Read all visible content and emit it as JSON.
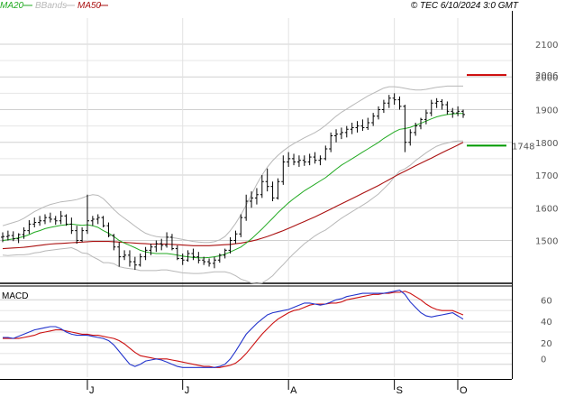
{
  "header": {
    "legend_ma20": "MA20",
    "legend_bbands": "BBands",
    "legend_ma50": "MA50",
    "source": "© TEC 6/10/2024 3:0 GMT"
  },
  "colors": {
    "ma20": "#22aa22",
    "bbands": "#b8b8b8",
    "ma50": "#aa1111",
    "macd_line": "#2233cc",
    "macd_signal": "#cc1111",
    "grid": "#d0d0d0",
    "price_bar": "#000000"
  },
  "chart_data": [
    {
      "type": "line",
      "title": "",
      "price_ylim": [
        1380,
        2180
      ],
      "price_yticks": [
        "1500",
        "1600",
        "1700",
        "1800",
        "1900",
        "2000",
        "2100"
      ],
      "months": [
        "J",
        "J",
        "A",
        "S",
        "O"
      ],
      "levels": [
        {
          "label": "2006",
          "value": 2006,
          "color": "#cc0000"
        },
        {
          "label": "1748",
          "value": 1790,
          "color": "#009900"
        }
      ],
      "ohlc": [
        [
          1510,
          1525,
          1495,
          1512
        ],
        [
          1512,
          1530,
          1500,
          1515
        ],
        [
          1515,
          1528,
          1498,
          1505
        ],
        [
          1505,
          1522,
          1492,
          1518
        ],
        [
          1518,
          1540,
          1505,
          1530
        ],
        [
          1530,
          1562,
          1520,
          1550
        ],
        [
          1550,
          1570,
          1540,
          1555
        ],
        [
          1555,
          1575,
          1545,
          1560
        ],
        [
          1560,
          1580,
          1550,
          1570
        ],
        [
          1570,
          1585,
          1555,
          1565
        ],
        [
          1565,
          1575,
          1548,
          1560
        ],
        [
          1560,
          1590,
          1550,
          1575
        ],
        [
          1575,
          1580,
          1545,
          1550
        ],
        [
          1550,
          1570,
          1520,
          1530
        ],
        [
          1530,
          1545,
          1490,
          1500
        ],
        [
          1500,
          1540,
          1495,
          1530
        ],
        [
          1530,
          1640,
          1520,
          1560
        ],
        [
          1560,
          1575,
          1545,
          1565
        ],
        [
          1565,
          1580,
          1550,
          1570
        ],
        [
          1570,
          1575,
          1540,
          1545
        ],
        [
          1545,
          1555,
          1510,
          1515
        ],
        [
          1515,
          1520,
          1470,
          1480
        ],
        [
          1480,
          1495,
          1420,
          1450
        ],
        [
          1450,
          1470,
          1440,
          1455
        ],
        [
          1455,
          1470,
          1420,
          1435
        ],
        [
          1435,
          1450,
          1410,
          1425
        ],
        [
          1425,
          1460,
          1420,
          1450
        ],
        [
          1450,
          1480,
          1440,
          1470
        ],
        [
          1470,
          1490,
          1455,
          1480
        ],
        [
          1480,
          1500,
          1465,
          1490
        ],
        [
          1490,
          1505,
          1470,
          1485
        ],
        [
          1485,
          1525,
          1478,
          1510
        ],
        [
          1510,
          1520,
          1470,
          1475
        ],
        [
          1475,
          1485,
          1440,
          1445
        ],
        [
          1445,
          1460,
          1425,
          1440
        ],
        [
          1440,
          1470,
          1435,
          1460
        ],
        [
          1460,
          1475,
          1440,
          1450
        ],
        [
          1450,
          1465,
          1430,
          1440
        ],
        [
          1440,
          1450,
          1425,
          1435
        ],
        [
          1435,
          1445,
          1420,
          1430
        ],
        [
          1430,
          1450,
          1415,
          1440
        ],
        [
          1440,
          1460,
          1432,
          1455
        ],
        [
          1455,
          1475,
          1445,
          1470
        ],
        [
          1470,
          1510,
          1460,
          1500
        ],
        [
          1500,
          1530,
          1490,
          1520
        ],
        [
          1520,
          1580,
          1510,
          1570
        ],
        [
          1570,
          1640,
          1560,
          1620
        ],
        [
          1620,
          1650,
          1600,
          1630
        ],
        [
          1630,
          1660,
          1610,
          1640
        ],
        [
          1640,
          1700,
          1630,
          1680
        ],
        [
          1680,
          1720,
          1650,
          1665
        ],
        [
          1665,
          1680,
          1620,
          1630
        ],
        [
          1630,
          1690,
          1625,
          1680
        ],
        [
          1680,
          1760,
          1670,
          1740
        ],
        [
          1740,
          1770,
          1725,
          1750
        ],
        [
          1750,
          1765,
          1730,
          1740
        ],
        [
          1740,
          1760,
          1725,
          1745
        ],
        [
          1745,
          1760,
          1728,
          1740
        ],
        [
          1740,
          1765,
          1730,
          1755
        ],
        [
          1755,
          1770,
          1735,
          1745
        ],
        [
          1745,
          1760,
          1730,
          1750
        ],
        [
          1750,
          1790,
          1745,
          1780
        ],
        [
          1780,
          1830,
          1770,
          1820
        ],
        [
          1820,
          1840,
          1800,
          1825
        ],
        [
          1825,
          1845,
          1810,
          1830
        ],
        [
          1830,
          1850,
          1815,
          1840
        ],
        [
          1840,
          1860,
          1825,
          1845
        ],
        [
          1845,
          1865,
          1830,
          1850
        ],
        [
          1850,
          1870,
          1835,
          1845
        ],
        [
          1845,
          1875,
          1838,
          1860
        ],
        [
          1860,
          1890,
          1850,
          1880
        ],
        [
          1880,
          1910,
          1870,
          1900
        ],
        [
          1900,
          1930,
          1890,
          1920
        ],
        [
          1920,
          1945,
          1905,
          1935
        ],
        [
          1935,
          1950,
          1915,
          1930
        ],
        [
          1930,
          1940,
          1900,
          1910
        ],
        [
          1910,
          1915,
          1770,
          1800
        ],
        [
          1800,
          1840,
          1790,
          1830
        ],
        [
          1830,
          1860,
          1820,
          1850
        ],
        [
          1850,
          1875,
          1840,
          1870
        ],
        [
          1870,
          1900,
          1855,
          1890
        ],
        [
          1890,
          1930,
          1880,
          1920
        ],
        [
          1920,
          1935,
          1905,
          1925
        ],
        [
          1925,
          1932,
          1900,
          1915
        ],
        [
          1915,
          1925,
          1885,
          1895
        ],
        [
          1895,
          1905,
          1875,
          1890
        ],
        [
          1890,
          1910,
          1880,
          1895
        ],
        [
          1895,
          1900,
          1875,
          1885
        ]
      ],
      "ma20": [
        1500,
        1502,
        1505,
        1508,
        1512,
        1518,
        1525,
        1530,
        1536,
        1540,
        1543,
        1546,
        1548,
        1550,
        1548,
        1546,
        1548,
        1545,
        1540,
        1530,
        1522,
        1512,
        1500,
        1492,
        1485,
        1478,
        1470,
        1465,
        1462,
        1460,
        1460,
        1460,
        1458,
        1455,
        1452,
        1450,
        1448,
        1447,
        1447,
        1448,
        1450,
        1453,
        1458,
        1465,
        1472,
        1480,
        1492,
        1505,
        1520,
        1535,
        1552,
        1568,
        1585,
        1600,
        1615,
        1628,
        1640,
        1652,
        1662,
        1672,
        1682,
        1692,
        1705,
        1718,
        1730,
        1740,
        1750,
        1760,
        1770,
        1780,
        1790,
        1800,
        1812,
        1822,
        1832,
        1840,
        1842,
        1846,
        1852,
        1858,
        1865,
        1872,
        1878,
        1882,
        1885,
        1887,
        1888,
        1888
      ],
      "bb_upper": [
        1545,
        1550,
        1555,
        1560,
        1568,
        1578,
        1588,
        1596,
        1604,
        1610,
        1614,
        1618,
        1620,
        1622,
        1625,
        1630,
        1636,
        1640,
        1638,
        1628,
        1612,
        1595,
        1580,
        1568,
        1556,
        1544,
        1532,
        1522,
        1516,
        1512,
        1510,
        1510,
        1509,
        1506,
        1503,
        1500,
        1497,
        1495,
        1494,
        1494,
        1496,
        1502,
        1512,
        1530,
        1552,
        1578,
        1608,
        1640,
        1672,
        1700,
        1724,
        1744,
        1760,
        1774,
        1786,
        1796,
        1805,
        1814,
        1822,
        1830,
        1840,
        1852,
        1866,
        1880,
        1892,
        1902,
        1912,
        1922,
        1932,
        1942,
        1950,
        1958,
        1966,
        1970,
        1970,
        1968,
        1965,
        1962,
        1960,
        1960,
        1962,
        1965,
        1968,
        1970,
        1972,
        1972,
        1972,
        1972
      ],
      "bb_lower": [
        1455,
        1454,
        1455,
        1456,
        1456,
        1458,
        1462,
        1464,
        1468,
        1470,
        1472,
        1474,
        1476,
        1478,
        1471,
        1462,
        1460,
        1450,
        1442,
        1432,
        1432,
        1429,
        1420,
        1416,
        1414,
        1412,
        1408,
        1408,
        1408,
        1408,
        1410,
        1410,
        1407,
        1404,
        1401,
        1400,
        1399,
        1399,
        1400,
        1402,
        1404,
        1404,
        1404,
        1400,
        1392,
        1382,
        1376,
        1370,
        1368,
        1370,
        1380,
        1392,
        1410,
        1426,
        1444,
        1460,
        1475,
        1490,
        1502,
        1514,
        1524,
        1532,
        1544,
        1556,
        1568,
        1578,
        1588,
        1598,
        1608,
        1618,
        1630,
        1642,
        1658,
        1674,
        1694,
        1712,
        1719,
        1730,
        1744,
        1756,
        1768,
        1779,
        1788,
        1794,
        1798,
        1802,
        1804,
        1804
      ],
      "ma50": [
        1475,
        1476,
        1477,
        1478,
        1479,
        1481,
        1483,
        1485,
        1487,
        1489,
        1490,
        1491,
        1492,
        1493,
        1494,
        1495,
        1496,
        1497,
        1497,
        1497,
        1497,
        1496,
        1495,
        1494,
        1493,
        1492,
        1491,
        1490,
        1489,
        1489,
        1489,
        1489,
        1488,
        1487,
        1486,
        1485,
        1484,
        1484,
        1484,
        1484,
        1485,
        1486,
        1487,
        1488,
        1490,
        1492,
        1495,
        1498,
        1502,
        1507,
        1512,
        1518,
        1524,
        1530,
        1537,
        1544,
        1551,
        1558,
        1565,
        1572,
        1580,
        1588,
        1596,
        1604,
        1612,
        1620,
        1628,
        1636,
        1644,
        1652,
        1660,
        1668,
        1677,
        1686,
        1695,
        1704,
        1712,
        1720,
        1728,
        1736,
        1744,
        1752,
        1760,
        1768,
        1776,
        1784,
        1792,
        1800
      ]
    },
    {
      "type": "line",
      "title": "MACD",
      "macd_ylim": [
        -12,
        72
      ],
      "macd_yticks": [
        "20",
        "40",
        "60"
      ],
      "macd_yticks_partial": "0",
      "series": [
        {
          "name": "MACD",
          "values": [
            25,
            25,
            24,
            26,
            28,
            30,
            32,
            33,
            34,
            35,
            35,
            33,
            30,
            28,
            27,
            27,
            27,
            26,
            25,
            24,
            22,
            18,
            12,
            6,
            0,
            -2,
            0,
            3,
            4,
            5,
            4,
            2,
            0,
            -2,
            -3,
            -3,
            -3,
            -3,
            -3,
            -3,
            -3,
            -2,
            0,
            5,
            12,
            20,
            28,
            33,
            38,
            42,
            46,
            48,
            49,
            50,
            51,
            53,
            55,
            57,
            57,
            56,
            55,
            56,
            58,
            60,
            61,
            63,
            64,
            65,
            66,
            66,
            66,
            66,
            66,
            67,
            68,
            69,
            65,
            58,
            53,
            48,
            45,
            44,
            45,
            46,
            47,
            48,
            45,
            42
          ]
        },
        {
          "name": "Signal",
          "values": [
            24,
            24,
            24,
            24,
            25,
            26,
            27,
            29,
            30,
            31,
            32,
            32,
            31,
            30,
            29,
            28,
            28,
            27,
            27,
            26,
            25,
            24,
            22,
            19,
            15,
            11,
            8,
            7,
            6,
            5,
            5,
            5,
            4,
            3,
            2,
            1,
            0,
            -1,
            -2,
            -2,
            -3,
            -3,
            -2,
            -1,
            1,
            5,
            10,
            16,
            22,
            28,
            33,
            38,
            42,
            45,
            48,
            50,
            51,
            53,
            55,
            56,
            56,
            56,
            57,
            57,
            58,
            60,
            61,
            62,
            63,
            64,
            65,
            65,
            66,
            66,
            67,
            67,
            68,
            66,
            63,
            60,
            56,
            53,
            51,
            50,
            50,
            50,
            48,
            46
          ]
        }
      ]
    }
  ]
}
